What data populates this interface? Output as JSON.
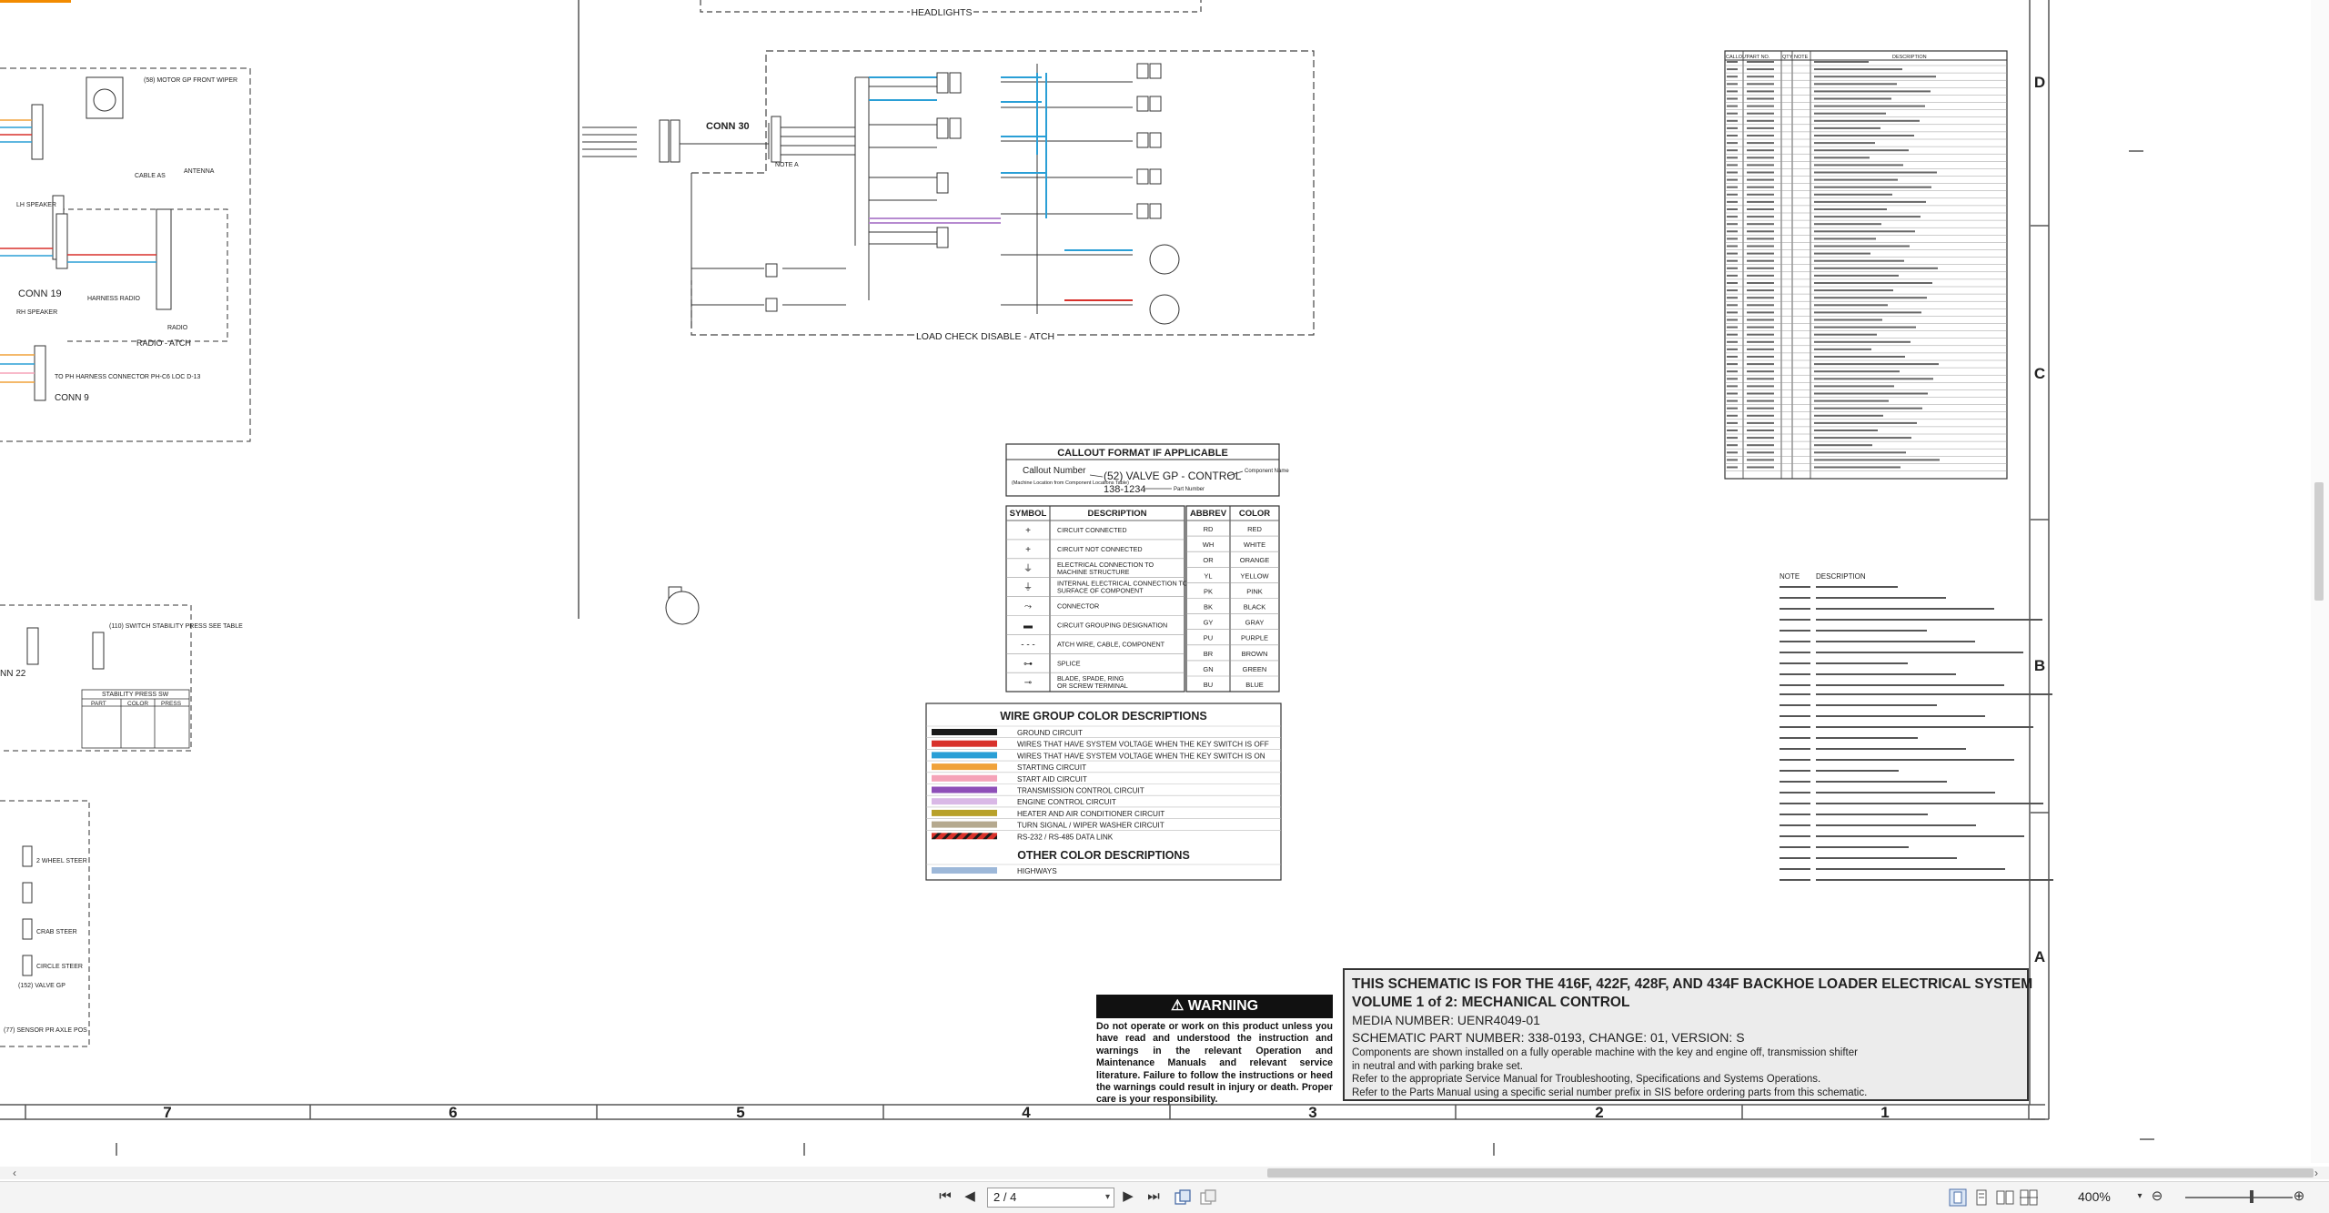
{
  "headlights_label": "HEADLIGHTS",
  "load_check_label": "LOAD CHECK DISABLE - ATCH",
  "conn30": "CONN 30",
  "conn19": "CONN 19",
  "conn9": "CONN 9",
  "conn22": "NN 22",
  "radio_atch": "RADIO - ATCH",
  "relay_note_a": "NOTE A",
  "left_labels": {
    "front_wiper": "(58) MOTOR GP FRONT WIPER",
    "antenna": "ANTENNA",
    "cable_as": "CABLE AS",
    "lh_speaker": "LH SPEAKER",
    "rh_speaker": "RH SPEAKER",
    "harness_radio": "HARNESS RADIO",
    "radio": "RADIO",
    "to_ph_harness": "TO PH HARNESS CONNECTOR PH-C6 LOC D-13",
    "stability_switch": "(110) SWITCH STABILITY PRESS SEE TABLE",
    "stability_table_title": "STABILITY PRESS SW",
    "stability_table_head": [
      "PART",
      "COLOR",
      "PRESS"
    ],
    "valve_gp": "(152) VALVE GP",
    "sensor": "(77) SENSOR PR AXLE POS",
    "wheel_steer": "2 WHEEL STEER",
    "crab_steer": "CRAB STEER",
    "circle_steer": "CIRCLE STEER"
  },
  "callout": {
    "title": "CALLOUT FORMAT IF APPLICABLE",
    "callout_number": "Callout Number",
    "callout_sub": "(Machine Location from Component Locations Table)",
    "example": "(52) VALVE GP - CONTROL",
    "part": "138-1234",
    "component_name": "Component Name",
    "part_number": "Part Number"
  },
  "symbols": {
    "head_symbol": "SYMBOL",
    "head_desc": "DESCRIPTION",
    "rows": [
      "CIRCUIT CONNECTED",
      "CIRCUIT NOT CONNECTED",
      "ELECTRICAL CONNECTION TO MACHINE STRUCTURE",
      "INTERNAL ELECTRICAL CONNECTION TO SURFACE OF COMPONENT",
      "CONNECTOR",
      "CIRCUIT GROUPING DESIGNATION",
      "ATCH WIRE, CABLE, COMPONENT",
      "SPLICE",
      "BLADE, SPADE, RING OR SCREW TERMINAL"
    ]
  },
  "abbrev": {
    "head_abbrev": "ABBREV",
    "head_color": "COLOR",
    "rows": [
      [
        "RD",
        "RED"
      ],
      [
        "WH",
        "WHITE"
      ],
      [
        "OR",
        "ORANGE"
      ],
      [
        "YL",
        "YELLOW"
      ],
      [
        "PK",
        "PINK"
      ],
      [
        "BK",
        "BLACK"
      ],
      [
        "GY",
        "GRAY"
      ],
      [
        "PU",
        "PURPLE"
      ],
      [
        "BR",
        "BROWN"
      ],
      [
        "GN",
        "GREEN"
      ],
      [
        "BU",
        "BLUE"
      ]
    ]
  },
  "wire_group": {
    "title": "WIRE GROUP COLOR DESCRIPTIONS",
    "rows": [
      {
        "color": "#1a1a1a",
        "label": "GROUND CIRCUIT"
      },
      {
        "color": "#d8312b",
        "label": "WIRES THAT HAVE SYSTEM VOLTAGE WHEN THE KEY SWITCH IS OFF"
      },
      {
        "color": "#2a9fd6",
        "label": "WIRES THAT HAVE SYSTEM VOLTAGE WHEN THE KEY SWITCH IS ON"
      },
      {
        "color": "#f0a23a",
        "label": "STARTING CIRCUIT"
      },
      {
        "color": "#f5a3b8",
        "label": "START AID CIRCUIT"
      },
      {
        "color": "#8e4fb8",
        "label": "TRANSMISSION CONTROL CIRCUIT"
      },
      {
        "color": "#d9b8e6",
        "label": "ENGINE CONTROL CIRCUIT"
      },
      {
        "color": "#b8a12a",
        "label": "HEATER AND AIR CONDITIONER CIRCUIT"
      },
      {
        "color": "#b5a98e",
        "label": "TURN SIGNAL / WIPER WASHER CIRCUIT"
      },
      {
        "color": "hatch",
        "label": "RS-232 / RS-485 DATA LINK"
      }
    ],
    "other_title": "OTHER COLOR DESCRIPTIONS",
    "other_rows": [
      {
        "color": "#9db8d9",
        "label": "HIGHWAYS"
      }
    ]
  },
  "warning": {
    "title": "WARNING",
    "text": "Do not operate or work on this product unless you have read and understood the instruction and warnings in the relevant Operation and Maintenance Manuals and relevant service literature. Failure to follow the instructions or heed the warnings could result in injury or death. Proper care is your responsibility."
  },
  "title_block": {
    "line1": "THIS SCHEMATIC IS FOR THE 416F, 422F, 428F, AND 434F BACKHOE LOADER ELECTRICAL SYSTEM",
    "line2": "VOLUME 1 of 2: MECHANICAL CONTROL",
    "line3": "MEDIA NUMBER: UENR4049-01",
    "line4": "SCHEMATIC PART NUMBER: 338-0193, CHANGE: 01, VERSION: S",
    "line5": "Components are shown installed on a fully operable machine with the key and engine off, transmission shifter",
    "line6": "in neutral and with parking brake set.",
    "line7": "Refer to the appropriate Service Manual for Troubleshooting, Specifications and Systems Operations.",
    "line8": "Refer to the Parts Manual using a specific serial number prefix in SIS before ordering parts from this schematic."
  },
  "grid_columns": [
    "7",
    "6",
    "5",
    "4",
    "3",
    "2",
    "1"
  ],
  "grid_rows": [
    "D",
    "C",
    "B",
    "A"
  ],
  "component_table": {
    "head": [
      "CALLOUT",
      "PART NO.",
      "QTY",
      "NOTE",
      "DESCRIPTION"
    ]
  },
  "notes_head": [
    "NOTE",
    "DESCRIPTION"
  ],
  "viewer": {
    "page_value": "2 / 4",
    "zoom": "400%",
    "first_icon": "⏮",
    "prev_icon": "◀",
    "next_icon": "▶",
    "last_icon": "⏭",
    "scroll_left": "‹",
    "scroll_right": "›",
    "zoom_out": "⊖",
    "zoom_in": "⊕",
    "zoom_caret": "▾"
  }
}
